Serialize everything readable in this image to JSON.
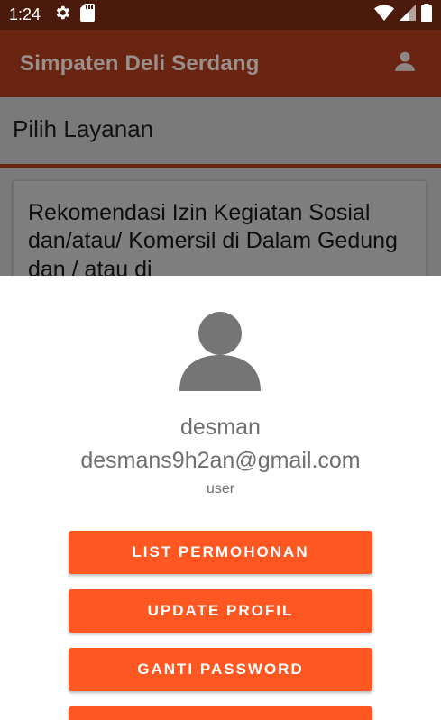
{
  "status_bar": {
    "time": "1:24",
    "left_icons": [
      "gear-icon",
      "sd-card-icon"
    ],
    "right_icons": [
      "wifi-icon",
      "signal-icon",
      "battery-icon"
    ]
  },
  "app_bar": {
    "title": "Simpaten Deli Serdang",
    "account_icon": "account-icon"
  },
  "content": {
    "section_title": "Pilih Layanan",
    "service_card_text": "Rekomendasi Izin Kegiatan Sosial  dan/atau/ Komersil di Dalam Gedung dan / atau di"
  },
  "profile_sheet": {
    "avatar_icon": "person-icon",
    "name": "desman",
    "email": "desmans9h2an@gmail.com",
    "role": "user",
    "buttons": [
      {
        "label": "LIST PERMOHONAN"
      },
      {
        "label": "UPDATE PROFIL"
      },
      {
        "label": "GANTI PASSWORD"
      },
      {
        "label": ""
      }
    ]
  },
  "colors": {
    "status_bar": "#4a1b0c",
    "app_bar": "#6a2512",
    "button": "#ff5722",
    "scrim_gray": "#7a7a7a"
  }
}
